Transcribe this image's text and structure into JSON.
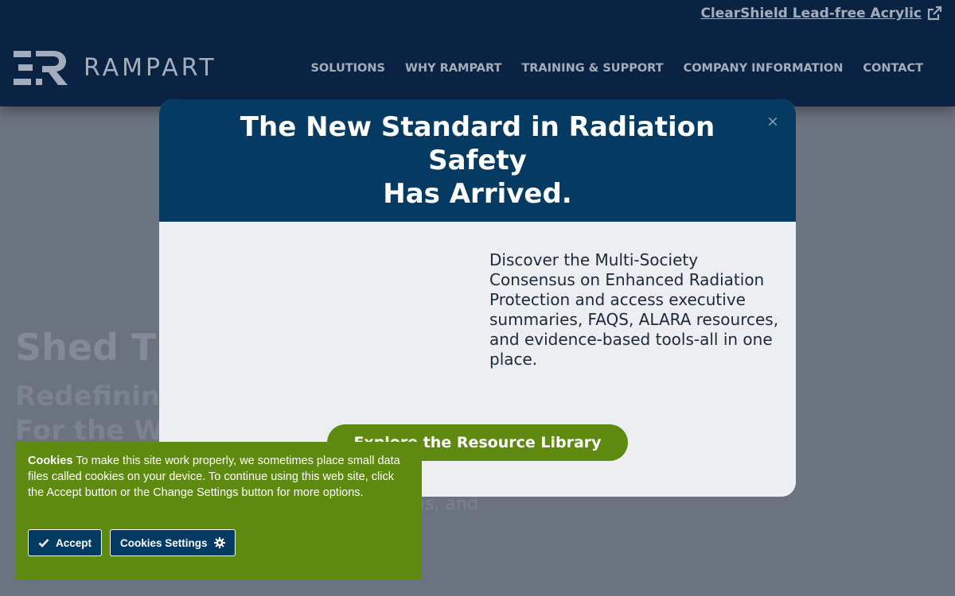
{
  "header": {
    "top_link": "ClearShield Lead-free Acrylic",
    "logo_text": "RAMPART",
    "nav": [
      "SOLUTIONS",
      "WHY RAMPART",
      "TRAINING & SUPPORT",
      "COMPANY INFORMATION",
      "CONTACT"
    ]
  },
  "hero": {
    "title": "Shed Th",
    "sub_line1": "Redefinin",
    "sub_line2": "For the W",
    "tail": "ns, and"
  },
  "modal": {
    "close": "×",
    "title_line1": "The New Standard in Radiation Safety",
    "title_line2": "Has Arrived.",
    "text": "Discover the Multi-Society Consensus on Enhanced Radiation Protection and access executive summaries, FAQS, ALARA resources, and evidence-based tools-all in one place.",
    "cta": "Explore the Resource Library"
  },
  "cookie": {
    "heading": "Cookies",
    "text": " To make this site work properly, we sometimes place small data files called cookies on your device. To continue using this web site, click the Accept button or the Change Settings button for more options.",
    "accept": "Accept",
    "settings": "Cookies Settings"
  },
  "colors": {
    "header_bg": "#0a2342",
    "modal_head": "#053b63",
    "green": "#5f8a10",
    "overlay": "#6c7380"
  },
  "icons": {
    "external_link": "external-link-icon",
    "check": "check-icon",
    "gear": "gear-icon",
    "close": "close-icon"
  }
}
